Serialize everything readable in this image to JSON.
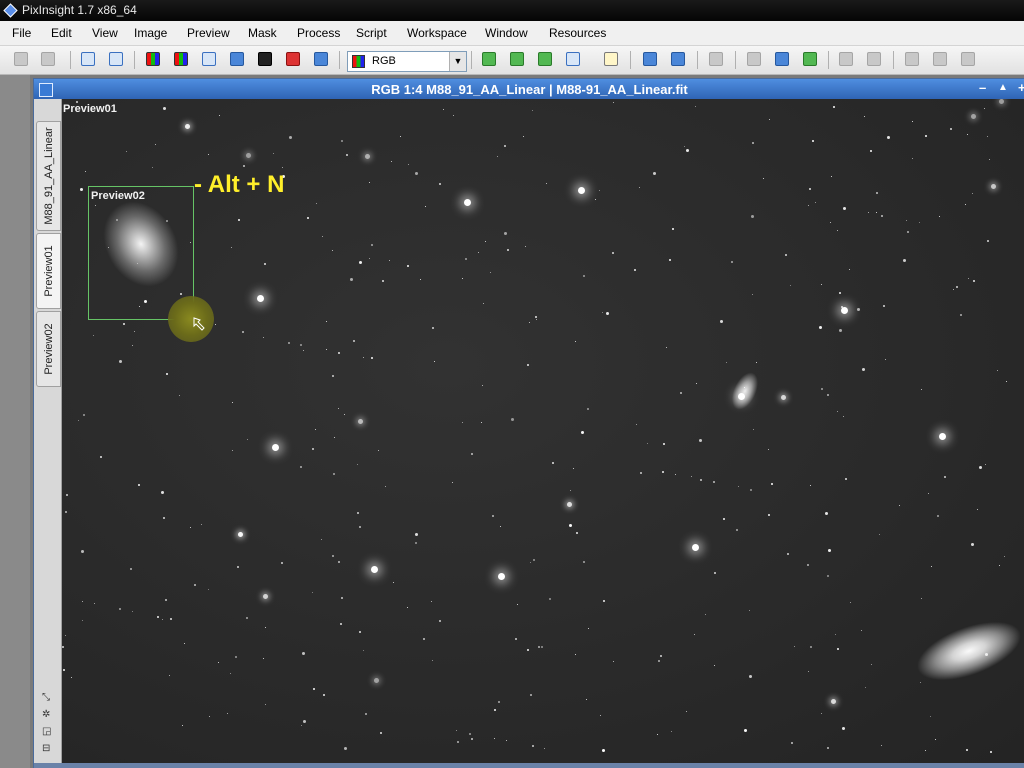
{
  "app": {
    "title": "PixInsight 1.7 x86_64"
  },
  "menu": {
    "items": [
      "File",
      "Edit",
      "View",
      "Image",
      "Preview",
      "Mask",
      "Process",
      "Script",
      "Workspace",
      "Window",
      "Resources"
    ]
  },
  "toolbar": {
    "channel_select": {
      "value": "RGB"
    }
  },
  "image_window": {
    "title": "RGB 1:4 M88_91_AA_Linear | M88-91_AA_Linear.fit",
    "controls": {
      "minimize": "–",
      "maximize": "▲",
      "extra": "+"
    }
  },
  "side_tabs": [
    "M88_91_AA_Linear",
    "Preview01",
    "Preview02"
  ],
  "image_area": {
    "preview01_label": "Preview01",
    "preview02_label": "Preview02",
    "annotation": "- Alt + N"
  },
  "colors": {
    "accent": "#2f64b4",
    "annotation": "#ffef2a",
    "preview_border": "#66c466"
  }
}
